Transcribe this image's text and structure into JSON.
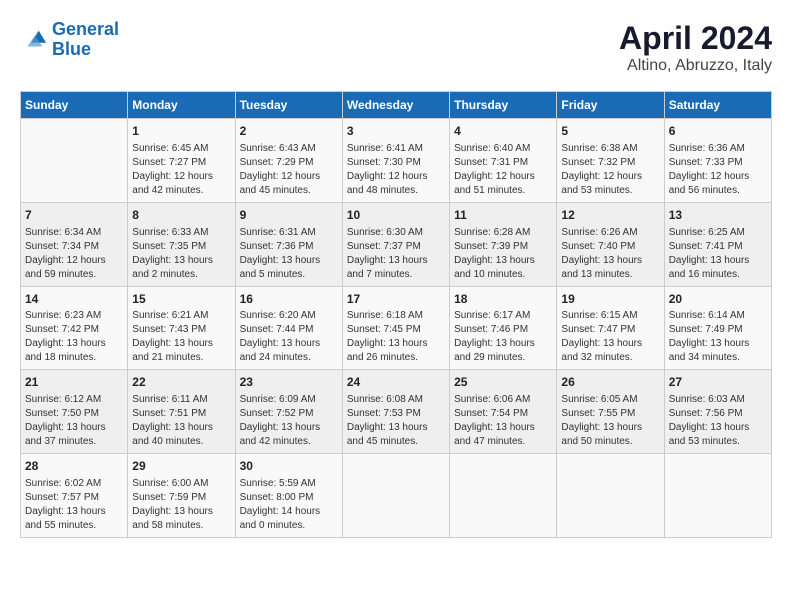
{
  "header": {
    "logo_line1": "General",
    "logo_line2": "Blue",
    "title": "April 2024",
    "subtitle": "Altino, Abruzzo, Italy"
  },
  "columns": [
    "Sunday",
    "Monday",
    "Tuesday",
    "Wednesday",
    "Thursday",
    "Friday",
    "Saturday"
  ],
  "weeks": [
    [
      {
        "day": "",
        "info": ""
      },
      {
        "day": "1",
        "info": "Sunrise: 6:45 AM\nSunset: 7:27 PM\nDaylight: 12 hours\nand 42 minutes."
      },
      {
        "day": "2",
        "info": "Sunrise: 6:43 AM\nSunset: 7:29 PM\nDaylight: 12 hours\nand 45 minutes."
      },
      {
        "day": "3",
        "info": "Sunrise: 6:41 AM\nSunset: 7:30 PM\nDaylight: 12 hours\nand 48 minutes."
      },
      {
        "day": "4",
        "info": "Sunrise: 6:40 AM\nSunset: 7:31 PM\nDaylight: 12 hours\nand 51 minutes."
      },
      {
        "day": "5",
        "info": "Sunrise: 6:38 AM\nSunset: 7:32 PM\nDaylight: 12 hours\nand 53 minutes."
      },
      {
        "day": "6",
        "info": "Sunrise: 6:36 AM\nSunset: 7:33 PM\nDaylight: 12 hours\nand 56 minutes."
      }
    ],
    [
      {
        "day": "7",
        "info": "Sunrise: 6:34 AM\nSunset: 7:34 PM\nDaylight: 12 hours\nand 59 minutes."
      },
      {
        "day": "8",
        "info": "Sunrise: 6:33 AM\nSunset: 7:35 PM\nDaylight: 13 hours\nand 2 minutes."
      },
      {
        "day": "9",
        "info": "Sunrise: 6:31 AM\nSunset: 7:36 PM\nDaylight: 13 hours\nand 5 minutes."
      },
      {
        "day": "10",
        "info": "Sunrise: 6:30 AM\nSunset: 7:37 PM\nDaylight: 13 hours\nand 7 minutes."
      },
      {
        "day": "11",
        "info": "Sunrise: 6:28 AM\nSunset: 7:39 PM\nDaylight: 13 hours\nand 10 minutes."
      },
      {
        "day": "12",
        "info": "Sunrise: 6:26 AM\nSunset: 7:40 PM\nDaylight: 13 hours\nand 13 minutes."
      },
      {
        "day": "13",
        "info": "Sunrise: 6:25 AM\nSunset: 7:41 PM\nDaylight: 13 hours\nand 16 minutes."
      }
    ],
    [
      {
        "day": "14",
        "info": "Sunrise: 6:23 AM\nSunset: 7:42 PM\nDaylight: 13 hours\nand 18 minutes."
      },
      {
        "day": "15",
        "info": "Sunrise: 6:21 AM\nSunset: 7:43 PM\nDaylight: 13 hours\nand 21 minutes."
      },
      {
        "day": "16",
        "info": "Sunrise: 6:20 AM\nSunset: 7:44 PM\nDaylight: 13 hours\nand 24 minutes."
      },
      {
        "day": "17",
        "info": "Sunrise: 6:18 AM\nSunset: 7:45 PM\nDaylight: 13 hours\nand 26 minutes."
      },
      {
        "day": "18",
        "info": "Sunrise: 6:17 AM\nSunset: 7:46 PM\nDaylight: 13 hours\nand 29 minutes."
      },
      {
        "day": "19",
        "info": "Sunrise: 6:15 AM\nSunset: 7:47 PM\nDaylight: 13 hours\nand 32 minutes."
      },
      {
        "day": "20",
        "info": "Sunrise: 6:14 AM\nSunset: 7:49 PM\nDaylight: 13 hours\nand 34 minutes."
      }
    ],
    [
      {
        "day": "21",
        "info": "Sunrise: 6:12 AM\nSunset: 7:50 PM\nDaylight: 13 hours\nand 37 minutes."
      },
      {
        "day": "22",
        "info": "Sunrise: 6:11 AM\nSunset: 7:51 PM\nDaylight: 13 hours\nand 40 minutes."
      },
      {
        "day": "23",
        "info": "Sunrise: 6:09 AM\nSunset: 7:52 PM\nDaylight: 13 hours\nand 42 minutes."
      },
      {
        "day": "24",
        "info": "Sunrise: 6:08 AM\nSunset: 7:53 PM\nDaylight: 13 hours\nand 45 minutes."
      },
      {
        "day": "25",
        "info": "Sunrise: 6:06 AM\nSunset: 7:54 PM\nDaylight: 13 hours\nand 47 minutes."
      },
      {
        "day": "26",
        "info": "Sunrise: 6:05 AM\nSunset: 7:55 PM\nDaylight: 13 hours\nand 50 minutes."
      },
      {
        "day": "27",
        "info": "Sunrise: 6:03 AM\nSunset: 7:56 PM\nDaylight: 13 hours\nand 53 minutes."
      }
    ],
    [
      {
        "day": "28",
        "info": "Sunrise: 6:02 AM\nSunset: 7:57 PM\nDaylight: 13 hours\nand 55 minutes."
      },
      {
        "day": "29",
        "info": "Sunrise: 6:00 AM\nSunset: 7:59 PM\nDaylight: 13 hours\nand 58 minutes."
      },
      {
        "day": "30",
        "info": "Sunrise: 5:59 AM\nSunset: 8:00 PM\nDaylight: 14 hours\nand 0 minutes."
      },
      {
        "day": "",
        "info": ""
      },
      {
        "day": "",
        "info": ""
      },
      {
        "day": "",
        "info": ""
      },
      {
        "day": "",
        "info": ""
      }
    ]
  ]
}
